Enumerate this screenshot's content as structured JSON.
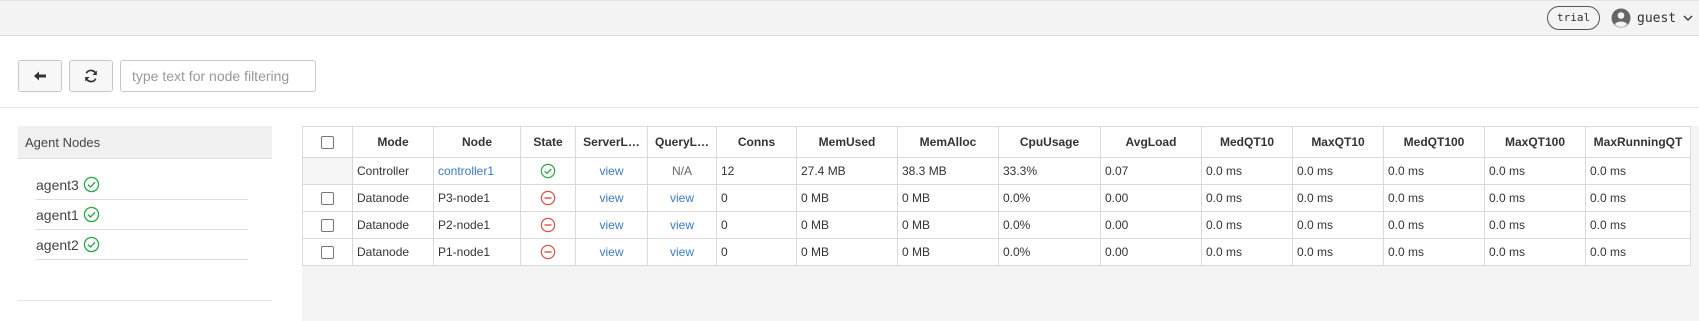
{
  "header": {
    "badge": "trial",
    "user_name": "guest"
  },
  "toolbar": {
    "filter_placeholder": "type text for node filtering",
    "filter_value": ""
  },
  "agents": {
    "title": "Agent Nodes",
    "items": [
      {
        "name": "agent3",
        "status": "ok"
      },
      {
        "name": "agent1",
        "status": "ok"
      },
      {
        "name": "agent2",
        "status": "ok"
      }
    ]
  },
  "table": {
    "columns": [
      "Mode",
      "Node",
      "State",
      "ServerL…",
      "QueryL…",
      "Conns",
      "MemUsed",
      "MemAlloc",
      "CpuUsage",
      "AvgLoad",
      "MedQT10",
      "MaxQT10",
      "MedQT100",
      "MaxQT100",
      "MaxRunningQT"
    ],
    "rows": [
      {
        "mode": "Controller",
        "node": "controller1",
        "state": "ok",
        "server_log": "view",
        "query_log": "N/A",
        "conns": "12",
        "mem_used": "27.4 MB",
        "mem_alloc": "38.3 MB",
        "cpu": "33.3%",
        "avg_load": "0.07",
        "medqt10": "0.0 ms",
        "maxqt10": "0.0 ms",
        "medqt100": "0.0 ms",
        "maxqt100": "0.0 ms",
        "maxrunning": "0.0 ms"
      },
      {
        "mode": "Datanode",
        "node": "P3-node1",
        "state": "stopped",
        "server_log": "view",
        "query_log": "view",
        "conns": "0",
        "mem_used": "0 MB",
        "mem_alloc": "0 MB",
        "cpu": "0.0%",
        "avg_load": "0.00",
        "medqt10": "0.0 ms",
        "maxqt10": "0.0 ms",
        "medqt100": "0.0 ms",
        "maxqt100": "0.0 ms",
        "maxrunning": "0.0 ms"
      },
      {
        "mode": "Datanode",
        "node": "P2-node1",
        "state": "stopped",
        "server_log": "view",
        "query_log": "view",
        "conns": "0",
        "mem_used": "0 MB",
        "mem_alloc": "0 MB",
        "cpu": "0.0%",
        "avg_load": "0.00",
        "medqt10": "0.0 ms",
        "maxqt10": "0.0 ms",
        "medqt100": "0.0 ms",
        "maxqt100": "0.0 ms",
        "maxrunning": "0.0 ms"
      },
      {
        "mode": "Datanode",
        "node": "P1-node1",
        "state": "stopped",
        "server_log": "view",
        "query_log": "view",
        "conns": "0",
        "mem_used": "0 MB",
        "mem_alloc": "0 MB",
        "cpu": "0.0%",
        "avg_load": "0.00",
        "medqt10": "0.0 ms",
        "maxqt10": "0.0 ms",
        "medqt100": "0.0 ms",
        "maxqt100": "0.0 ms",
        "maxrunning": "0.0 ms"
      }
    ]
  },
  "colors": {
    "ok": "#2ea84a",
    "stopped": "#d9534f",
    "link": "#3b7bc4"
  },
  "icons": {
    "back": "arrow-left-icon",
    "refresh": "refresh-icon",
    "user": "user-avatar-icon",
    "dropdown": "chevron-down-icon",
    "ok": "check-circle-icon",
    "stopped": "minus-circle-icon"
  }
}
